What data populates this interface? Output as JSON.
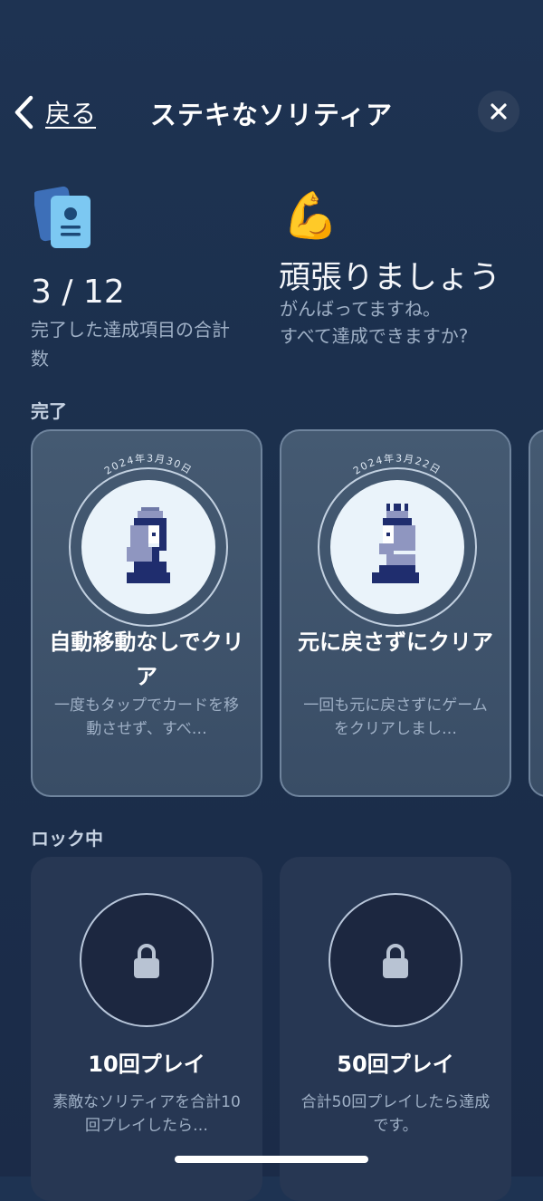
{
  "nav": {
    "back_label": "戻る",
    "title": "ステキなソリティア"
  },
  "summary": {
    "count": "3 / 12",
    "count_desc": "完了した達成項目の合計数",
    "flex_emoji": "💪",
    "encourage_title": "頑張りましょう",
    "encourage_sub_line1": "がんばってますね。",
    "encourage_sub_line2": "すべて達成できますか?"
  },
  "sections": {
    "completed_label": "完了",
    "locked_label": "ロック中"
  },
  "completed": [
    {
      "date": "2024年3月30日",
      "title": "自動移動なしでクリア",
      "desc": "一度もタップでカードを移動させず、すべ…"
    },
    {
      "date": "2024年3月22日",
      "title": "元に戻さずにクリア",
      "desc": "一回も元に戻さずにゲームをクリアしまし…"
    }
  ],
  "locked": [
    {
      "title": "10回プレイ",
      "desc": "素敵なソリティアを合計10回プレイしたら…"
    },
    {
      "title": "50回プレイ",
      "desc": "合計50回プレイしたら達成です。"
    }
  ],
  "icons": {
    "back": "chevron-left-icon",
    "close": "close-icon",
    "summary": "achievement-cards-icon",
    "lock": "lock-icon"
  },
  "colors": {
    "background": "#1e3352",
    "card_completed": "#455a72",
    "card_locked": "#273753",
    "secondary_text": "#9fb0c6"
  }
}
